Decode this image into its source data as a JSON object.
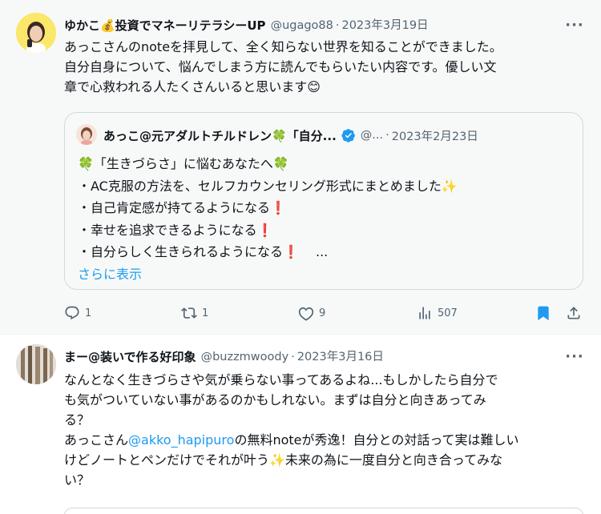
{
  "colors": {
    "text": "#0f1419",
    "secondary": "#536471",
    "link": "#1d9bf0",
    "bookmark": "#1d9bf0",
    "verified": "#1d9bf0"
  },
  "tweet1": {
    "display_name": "ゆかこ💰投資でマネーリテラシーUP",
    "handle": "@ugago88",
    "separator": "·",
    "date": "2023年3月19日",
    "body_lines": [
      "あっこさんのnoteを拝見して、全く知らない世界を知ることができました。",
      "自分自身について、悩んでしまう方に読んでもらいたい内容です。優しい文",
      "章で心救われる人たくさんいると思います😊"
    ],
    "quote": {
      "display_name": "あっこ@元アダルトチルドレン🍀「自分...",
      "handle": "@...",
      "separator": "·",
      "date": "2023年2月23日",
      "lines": [
        "🍀「生きづらさ」に悩むあなたへ🍀",
        "・AC克服の方法を、セルフカウンセリング形式にまとめました✨",
        "・自己肯定感が持てるようになる❗",
        "・幸せを追求できるようになる❗",
        "・自分らしく生きられるようになる❗　 ..."
      ],
      "show_more": "さらに表示"
    },
    "actions": {
      "reply_count": "1",
      "retweet_count": "1",
      "like_count": "9",
      "view_count": "507"
    }
  },
  "tweet2": {
    "display_name": "まー@装いで作る好印象",
    "handle": "@buzzmwoody",
    "separator": "·",
    "date": "2023年3月16日",
    "lines": {
      "l1": "なんとなく生きづらさや気が乗らない事ってあるよね...もしかしたら自分で",
      "l2": "も気がついていない事があるのかもしれない。まずは自分と向きあってみ",
      "l3": "る？",
      "l4_pre": "あっこさん",
      "l4_mention": "@akko_hapipuro",
      "l4_post": "の無料noteが秀逸！自分との対話って実は難しい",
      "l5": "けどノートとペンだけでそれが叶う✨未来の為に一度自分と向き合ってみな",
      "l6": "い？"
    }
  },
  "icons": [
    "more-icon",
    "reply-icon",
    "retweet-icon",
    "like-icon",
    "views-icon",
    "bookmark-icon",
    "share-icon",
    "verified-badge-icon"
  ]
}
